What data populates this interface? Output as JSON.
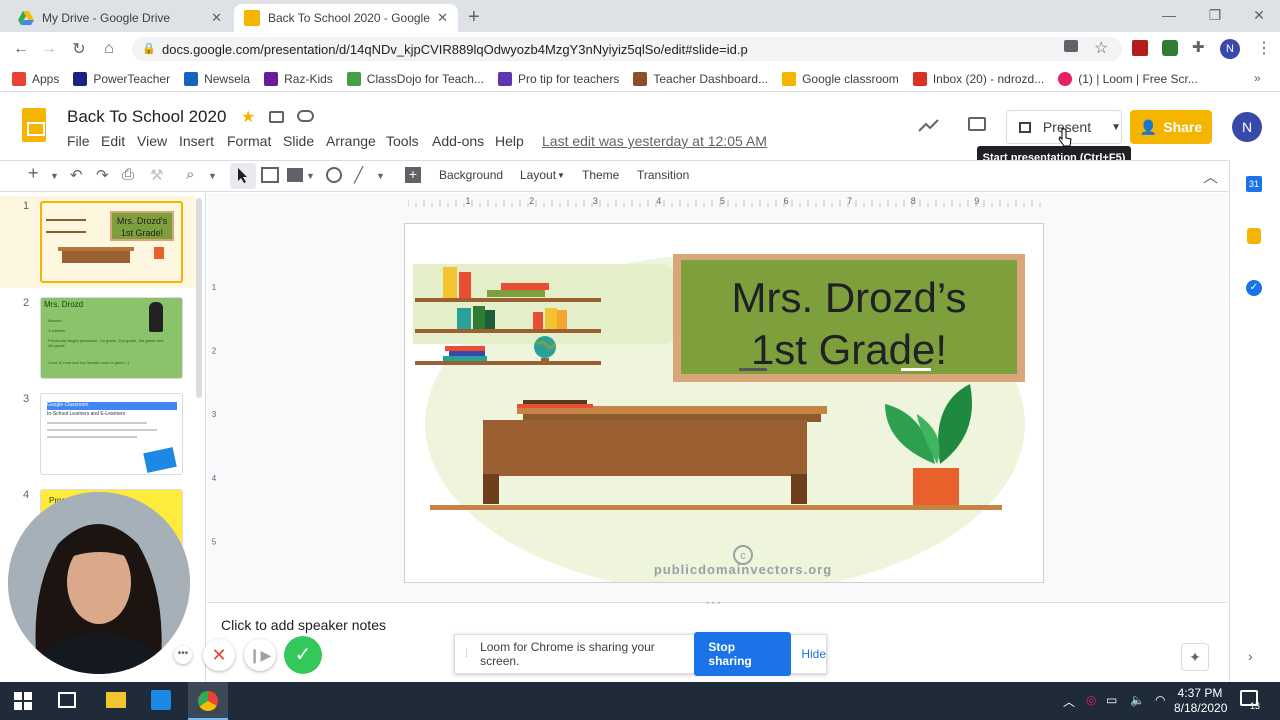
{
  "browser": {
    "tabs": [
      {
        "title": "My Drive - Google Drive",
        "active": false
      },
      {
        "title": "Back To School 2020 - Google",
        "active": true
      }
    ],
    "url": "docs.google.com/presentation/d/14qNDv_kjpCVIR889lqOdwyozb4MzgY3nNyiyiz5qlSo/edit#slide=id.p",
    "profile_initial": "N"
  },
  "bookmarks": [
    {
      "label": "Apps",
      "color": "#ea4335"
    },
    {
      "label": "PowerTeacher",
      "color": "#1a237e"
    },
    {
      "label": "Newsela",
      "color": "#1565c0"
    },
    {
      "label": "Raz-Kids",
      "color": "#6a1b9a"
    },
    {
      "label": "ClassDojo for Teach...",
      "color": "#43a047"
    },
    {
      "label": "Pro tip for teachers",
      "color": "#5e35b1"
    },
    {
      "label": "Teacher Dashboard...",
      "color": "#8d4e2a"
    },
    {
      "label": "Google classroom",
      "color": "#f4b400"
    },
    {
      "label": "Inbox (20) - ndrozd...",
      "color": "#d93025"
    },
    {
      "label": "(1) | Loom | Free Scr...",
      "color": "#e91e63"
    }
  ],
  "doc": {
    "title": "Back To School 2020",
    "menus": [
      "File",
      "Edit",
      "View",
      "Insert",
      "Format",
      "Slide",
      "Arrange",
      "Tools",
      "Add-ons",
      "Help"
    ],
    "last_edit": "Last edit was yesterday at 12:05 AM",
    "present_label": "Present",
    "share_label": "Share",
    "user_initial": "N",
    "tooltip": "Start presentation (Ctrl+F5)"
  },
  "toolbar": {
    "background": "Background",
    "layout": "Layout",
    "theme": "Theme",
    "transition": "Transition"
  },
  "ruler_labels": [
    "1",
    "2",
    "3",
    "4",
    "5",
    "6",
    "7",
    "8",
    "9"
  ],
  "vruler_labels": [
    "1",
    "2",
    "3",
    "4",
    "5"
  ],
  "filmstrip": [
    {
      "num": "1",
      "title": "Mrs. Drozd's 1st Grade!"
    },
    {
      "num": "2",
      "title": "Mrs. Drozd",
      "lines": [
        "Married",
        "4 children",
        "Previously taught preschool, 1st grade, 2nd grade, 3rd grade and 4th grade",
        "I love to read and my favorite color is green. :)"
      ]
    },
    {
      "num": "3",
      "title": "Google Classroom",
      "subtitle": "In-School Learners and E-Learners"
    },
    {
      "num": "4",
      "title": "Procedures"
    }
  ],
  "slide": {
    "heading_line1": "Mrs. Drozd’s",
    "heading_line2": "1st Grade!",
    "watermark": "publicdomainvectors.org"
  },
  "notes_placeholder": "Click to add speaker notes",
  "loom": {
    "message": "Loom for Chrome is sharing your screen.",
    "stop": "Stop sharing",
    "hide": "Hide"
  },
  "taskbar": {
    "time": "4:37 PM",
    "date": "8/18/2020",
    "notifications": "13"
  }
}
